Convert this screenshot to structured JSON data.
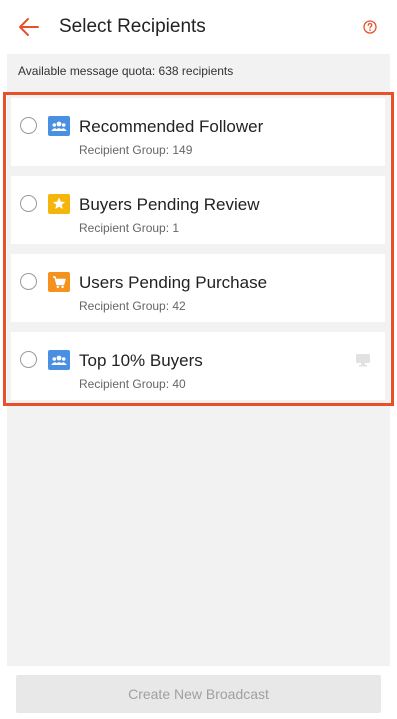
{
  "header": {
    "title": "Select Recipients",
    "back_icon": "arrow-left-icon",
    "help_icon": "question-circle-icon",
    "accent_color": "#e8502a"
  },
  "quota": {
    "text": "Available message quota: 638 recipients"
  },
  "groups": [
    {
      "name": "Recommended Follower",
      "subtitle": "Recipient Group: 149",
      "icon": "people-group-icon",
      "icon_color": "#4a90e2",
      "selected": false
    },
    {
      "name": "Buyers Pending Review",
      "subtitle": "Recipient Group: 1",
      "icon": "star-icon",
      "icon_color": "#f5b50b",
      "selected": false
    },
    {
      "name": "Users Pending Purchase",
      "subtitle": "Recipient Group: 42",
      "icon": "shopping-cart-icon",
      "icon_color": "#f5921e",
      "selected": false
    },
    {
      "name": "Top 10% Buyers",
      "subtitle": "Recipient Group: 40",
      "icon": "people-group-icon",
      "icon_color": "#4a90e2",
      "selected": false,
      "extra_icon": "monitor-icon"
    }
  ],
  "footer": {
    "button_label": "Create New Broadcast",
    "button_enabled": false
  }
}
